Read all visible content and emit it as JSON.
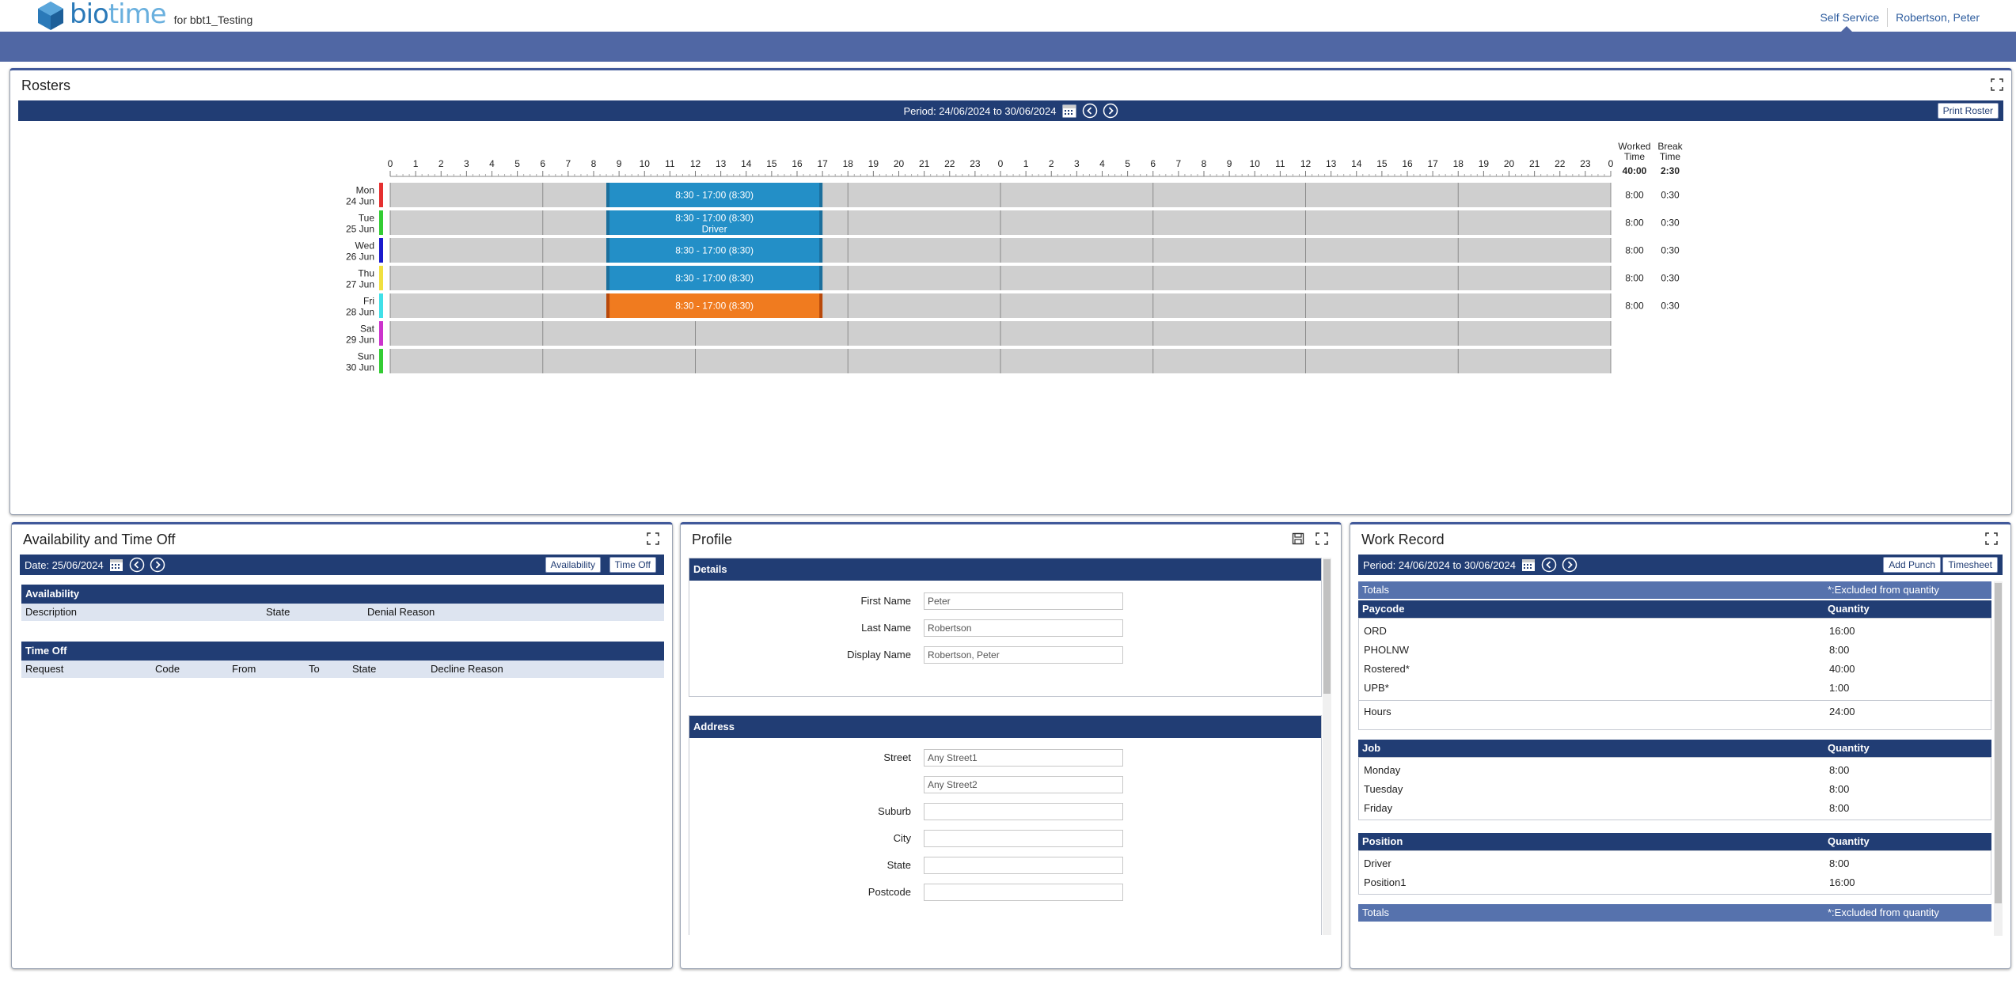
{
  "header": {
    "logo_bio": "bio",
    "logo_time": "time",
    "subtitle": "for bbt1_Testing",
    "nav_self_service": "Self Service",
    "nav_user": "Robertson, Peter"
  },
  "rosters": {
    "title": "Rosters",
    "period": "Period: 24/06/2024 to 30/06/2024",
    "print_label": "Print Roster",
    "worked_time_label_1": "Worked",
    "worked_time_label_2": "Time",
    "break_time_label_1": "Break",
    "break_time_label_2": "Time",
    "total_worked": "40:00",
    "total_break": "2:30",
    "hours": [
      "0",
      "1",
      "2",
      "3",
      "4",
      "5",
      "6",
      "7",
      "8",
      "9",
      "10",
      "11",
      "12",
      "13",
      "14",
      "15",
      "16",
      "17",
      "18",
      "19",
      "20",
      "21",
      "22",
      "23",
      "0",
      "1",
      "2",
      "3",
      "4",
      "5",
      "6",
      "7",
      "8",
      "9",
      "10",
      "11",
      "12",
      "13",
      "14",
      "15",
      "16",
      "17",
      "18",
      "19",
      "20",
      "21",
      "22",
      "23",
      "0"
    ],
    "days": [
      {
        "dow": "Mon",
        "date": "24 Jun",
        "color": "#e53030",
        "shift": "8:30 - 17:00 (8:30)",
        "sub": "",
        "shift_color": "#238fc7",
        "start": 8.5,
        "end": 17,
        "worked": "8:00",
        "break": "0:30"
      },
      {
        "dow": "Tue",
        "date": "25 Jun",
        "color": "#33cc33",
        "shift": "8:30 - 17:00 (8:30)",
        "sub": "Driver",
        "shift_color": "#238fc7",
        "start": 8.5,
        "end": 17,
        "worked": "8:00",
        "break": "0:30"
      },
      {
        "dow": "Wed",
        "date": "26 Jun",
        "color": "#1a1acc",
        "shift": "8:30 - 17:00 (8:30)",
        "sub": "",
        "shift_color": "#238fc7",
        "start": 8.5,
        "end": 17,
        "worked": "8:00",
        "break": "0:30"
      },
      {
        "dow": "Thu",
        "date": "27 Jun",
        "color": "#f0e040",
        "shift": "8:30 - 17:00 (8:30)",
        "sub": "",
        "shift_color": "#238fc7",
        "start": 8.5,
        "end": 17,
        "worked": "8:00",
        "break": "0:30"
      },
      {
        "dow": "Fri",
        "date": "28 Jun",
        "color": "#40e0e8",
        "shift": "8:30 - 17:00 (8:30)",
        "sub": "",
        "shift_color": "#f07b1f",
        "start": 8.5,
        "end": 17,
        "worked": "8:00",
        "break": "0:30"
      },
      {
        "dow": "Sat",
        "date": "29 Jun",
        "color": "#cc33cc",
        "shift": "",
        "sub": "",
        "shift_color": "",
        "start": null,
        "end": null,
        "worked": "",
        "break": ""
      },
      {
        "dow": "Sun",
        "date": "30 Jun",
        "color": "#33cc33",
        "shift": "",
        "sub": "",
        "shift_color": "",
        "start": null,
        "end": null,
        "worked": "",
        "break": ""
      }
    ]
  },
  "availability": {
    "title": "Availability and Time Off",
    "date": "Date: 25/06/2024",
    "availability_btn": "Availability",
    "timeoff_btn": "Time Off",
    "availability_head": "Availability",
    "avail_cols": [
      "Description",
      "State",
      "Denial Reason"
    ],
    "timeoff_head": "Time Off",
    "timeoff_cols": [
      "Request",
      "Code",
      "From",
      "To",
      "State",
      "Decline Reason"
    ]
  },
  "profile": {
    "title": "Profile",
    "details_head": "Details",
    "first_name_label": "First Name",
    "first_name": "Peter",
    "last_name_label": "Last Name",
    "last_name": "Robertson",
    "display_name_label": "Display Name",
    "display_name": "Robertson, Peter",
    "address_head": "Address",
    "street_label": "Street",
    "street1": "Any Street1",
    "street2": "Any Street2",
    "suburb_label": "Suburb",
    "city_label": "City",
    "state_label": "State",
    "postcode_label": "Postcode"
  },
  "work_record": {
    "title": "Work Record",
    "period": "Period: 24/06/2024 to 30/06/2024",
    "add_punch": "Add Punch",
    "timesheet": "Timesheet",
    "totals_label": "Totals",
    "excluded_note": "*:Excluded from quantity",
    "paycode_head": "Paycode",
    "quantity_head": "Quantity",
    "paycodes": [
      {
        "name": "ORD",
        "qty": "16:00"
      },
      {
        "name": "PHOLNW",
        "qty": "8:00"
      },
      {
        "name": "Rostered*",
        "qty": "40:00"
      },
      {
        "name": "UPB*",
        "qty": "1:00"
      }
    ],
    "hours_label": "Hours",
    "hours_value": "24:00",
    "job_head": "Job",
    "jobs": [
      {
        "name": "Monday",
        "qty": "8:00"
      },
      {
        "name": "Tuesday",
        "qty": "8:00"
      },
      {
        "name": "Friday",
        "qty": "8:00"
      }
    ],
    "position_head": "Position",
    "positions": [
      {
        "name": "Driver",
        "qty": "8:00"
      },
      {
        "name": "Position1",
        "qty": "16:00"
      }
    ],
    "bottom_totals_label": "Totals",
    "bottom_excluded_note": "*:Excluded from quantity"
  }
}
